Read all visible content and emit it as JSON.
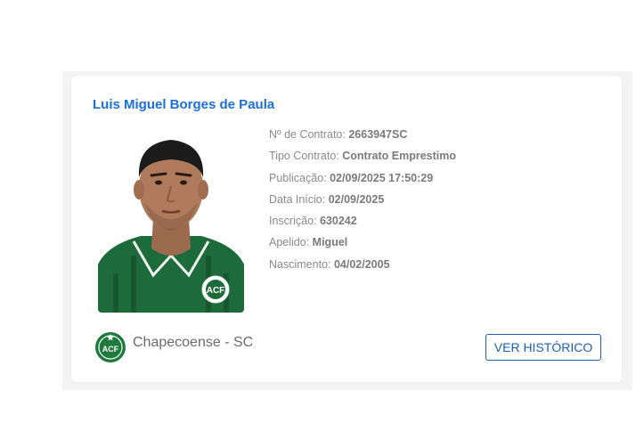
{
  "player": {
    "name": "Luis Miguel Borges de Paula",
    "fields": [
      {
        "label": "Nº de Contrato:",
        "value": "2663947SC"
      },
      {
        "label": "Tipo Contrato:",
        "value": "Contrato Emprestimo"
      },
      {
        "label": "Publicação:",
        "value": "02/09/2025 17:50:29"
      },
      {
        "label": "Data Início:",
        "value": "02/09/2025"
      },
      {
        "label": "Inscrição:",
        "value": "630242"
      },
      {
        "label": "Apelido:",
        "value": "Miguel"
      },
      {
        "label": "Nascimento:",
        "value": "04/02/2005"
      }
    ]
  },
  "club": {
    "name": "Chapecoense - SC",
    "logo_text": "ACF"
  },
  "actions": {
    "history_label": "VER HISTÓRICO"
  },
  "colors": {
    "name_blue": "#1c6fd6",
    "button_blue": "#1f5fa9",
    "club_green": "#1e7a3c"
  }
}
